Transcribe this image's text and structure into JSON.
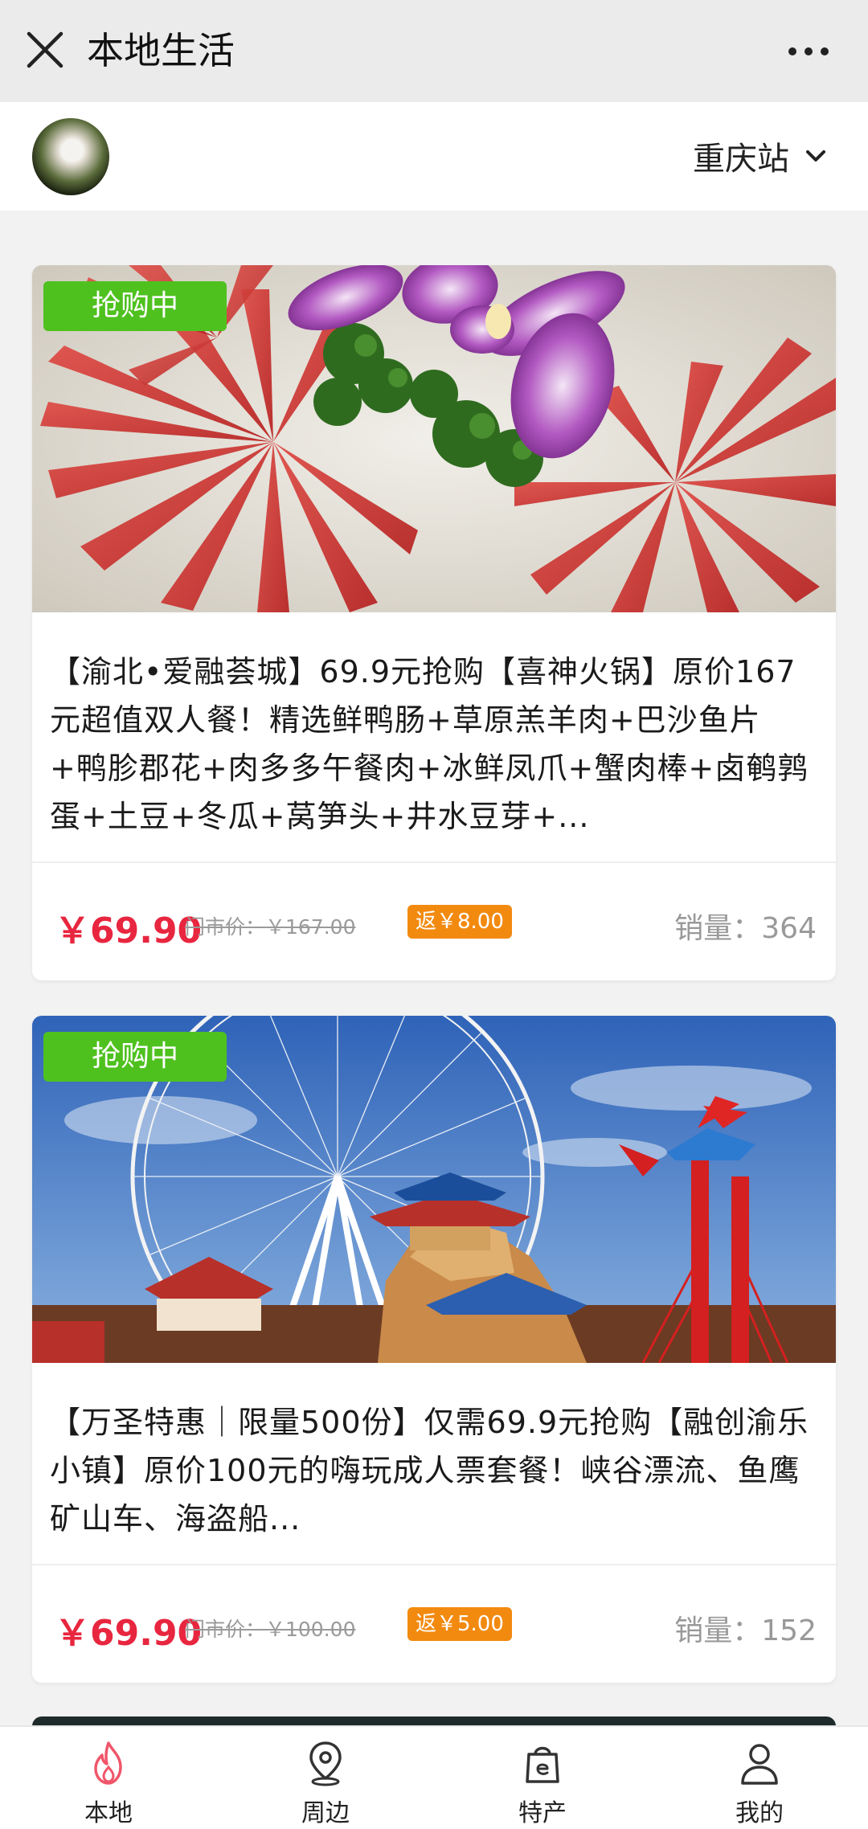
{
  "titlebar": {
    "title": "本地生活"
  },
  "header": {
    "city": "重庆站"
  },
  "cards": [
    {
      "badge": "抢购中",
      "description": "【渝北•爱融荟城】69.9元抢购【喜神火锅】原价167元超值双人餐！精选鲜鸭肠+草原羔羊肉+巴沙鱼片+鸭胗郡花+肉多多午餐肉+冰鲜凤爪+蟹肉棒+卤鹌鹑蛋+土豆+冬瓜+莴笋头+井水豆芽+...",
      "price": "￥69.90",
      "original_price": "门市价：￥167.00",
      "rebate": "返￥8.00",
      "sales": "销量：364"
    },
    {
      "badge": "抢购中",
      "description": "【万圣特惠｜限量500份】仅需69.9元抢购【融创渝乐小镇】原价100元的嗨玩成人票套餐！峡谷漂流、鱼鹰矿山车、海盗船...",
      "price": "￥69.90",
      "original_price": "门市价：￥100.00",
      "rebate": "返￥5.00",
      "sales": "销量：152"
    }
  ],
  "tabs": [
    {
      "label": "本地",
      "icon": "flame-icon",
      "active": true
    },
    {
      "label": "周边",
      "icon": "location-pin-icon",
      "active": false
    },
    {
      "label": "特产",
      "icon": "shopping-bag-icon",
      "active": false
    },
    {
      "label": "我的",
      "icon": "user-icon",
      "active": false
    }
  ],
  "colors": {
    "accent_price": "#e8263f",
    "badge_green": "#4fc11f",
    "rebate_orange": "#f28a10",
    "tab_active": "#f0566a"
  }
}
